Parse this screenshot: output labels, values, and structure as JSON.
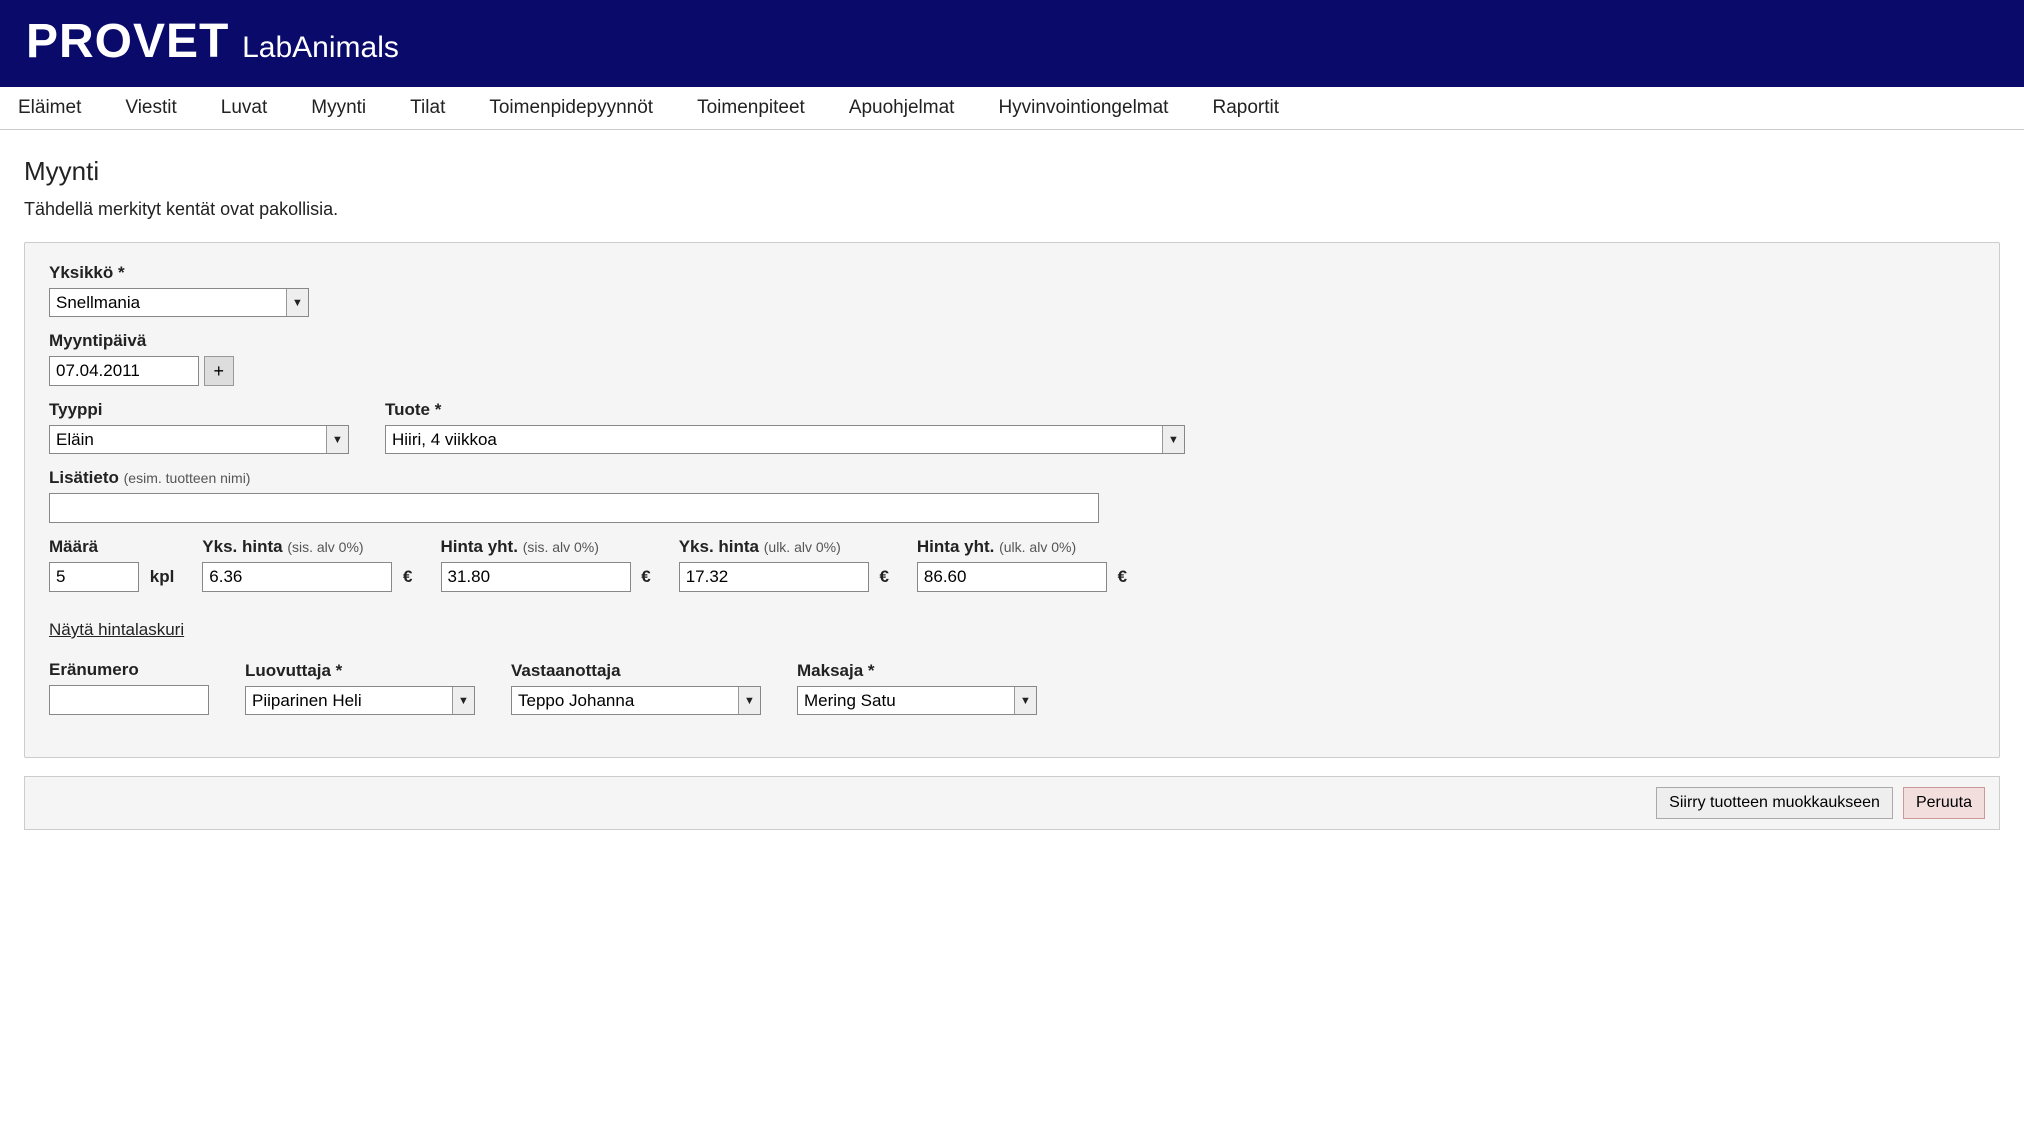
{
  "header": {
    "brand": "PROVET",
    "subbrand": "LabAnimals"
  },
  "nav": [
    "Eläimet",
    "Viestit",
    "Luvat",
    "Myynti",
    "Tilat",
    "Toimenpidepyynnöt",
    "Toimenpiteet",
    "Apuohjelmat",
    "Hyvinvointiongelmat",
    "Raportit"
  ],
  "page": {
    "title": "Myynti",
    "required_note": "Tähdellä merkityt kentät ovat pakollisia."
  },
  "form": {
    "unit_label": "Yksikkö *",
    "unit_value": "Snellmania",
    "date_label": "Myyntipäivä",
    "date_value": "07.04.2011",
    "date_btn": "+",
    "type_label": "Tyyppi",
    "type_value": "Eläin",
    "product_label": "Tuote *",
    "product_value": "Hiiri, 4 viikkoa",
    "extra_label_main": "Lisätieto",
    "extra_label_sub": "(esim. tuotteen nimi)",
    "extra_value": "",
    "qty_label": "Määrä",
    "qty_value": "5",
    "qty_unit": "kpl",
    "unitprice_in_label_main": "Yks. hinta",
    "unitprice_in_label_sub": "(sis. alv 0%)",
    "unitprice_in_value": "6.36",
    "total_in_label_main": "Hinta yht.",
    "total_in_label_sub": "(sis. alv 0%)",
    "total_in_value": "31.80",
    "unitprice_ex_label_main": "Yks. hinta",
    "unitprice_ex_label_sub": "(ulk. alv 0%)",
    "unitprice_ex_value": "17.32",
    "total_ex_label_main": "Hinta yht.",
    "total_ex_label_sub": "(ulk. alv 0%)",
    "total_ex_value": "86.60",
    "currency": "€",
    "calc_link": "Näytä hintalaskuri",
    "batch_label": "Eränumero",
    "batch_value": "",
    "giver_label": "Luovuttaja *",
    "giver_value": "Piiparinen Heli",
    "receiver_label": "Vastaanottaja",
    "receiver_value": "Teppo Johanna",
    "payer_label": "Maksaja *",
    "payer_value": "Mering Satu"
  },
  "actions": {
    "edit": "Siirry tuotteen muokkaukseen",
    "cancel": "Peruuta"
  }
}
